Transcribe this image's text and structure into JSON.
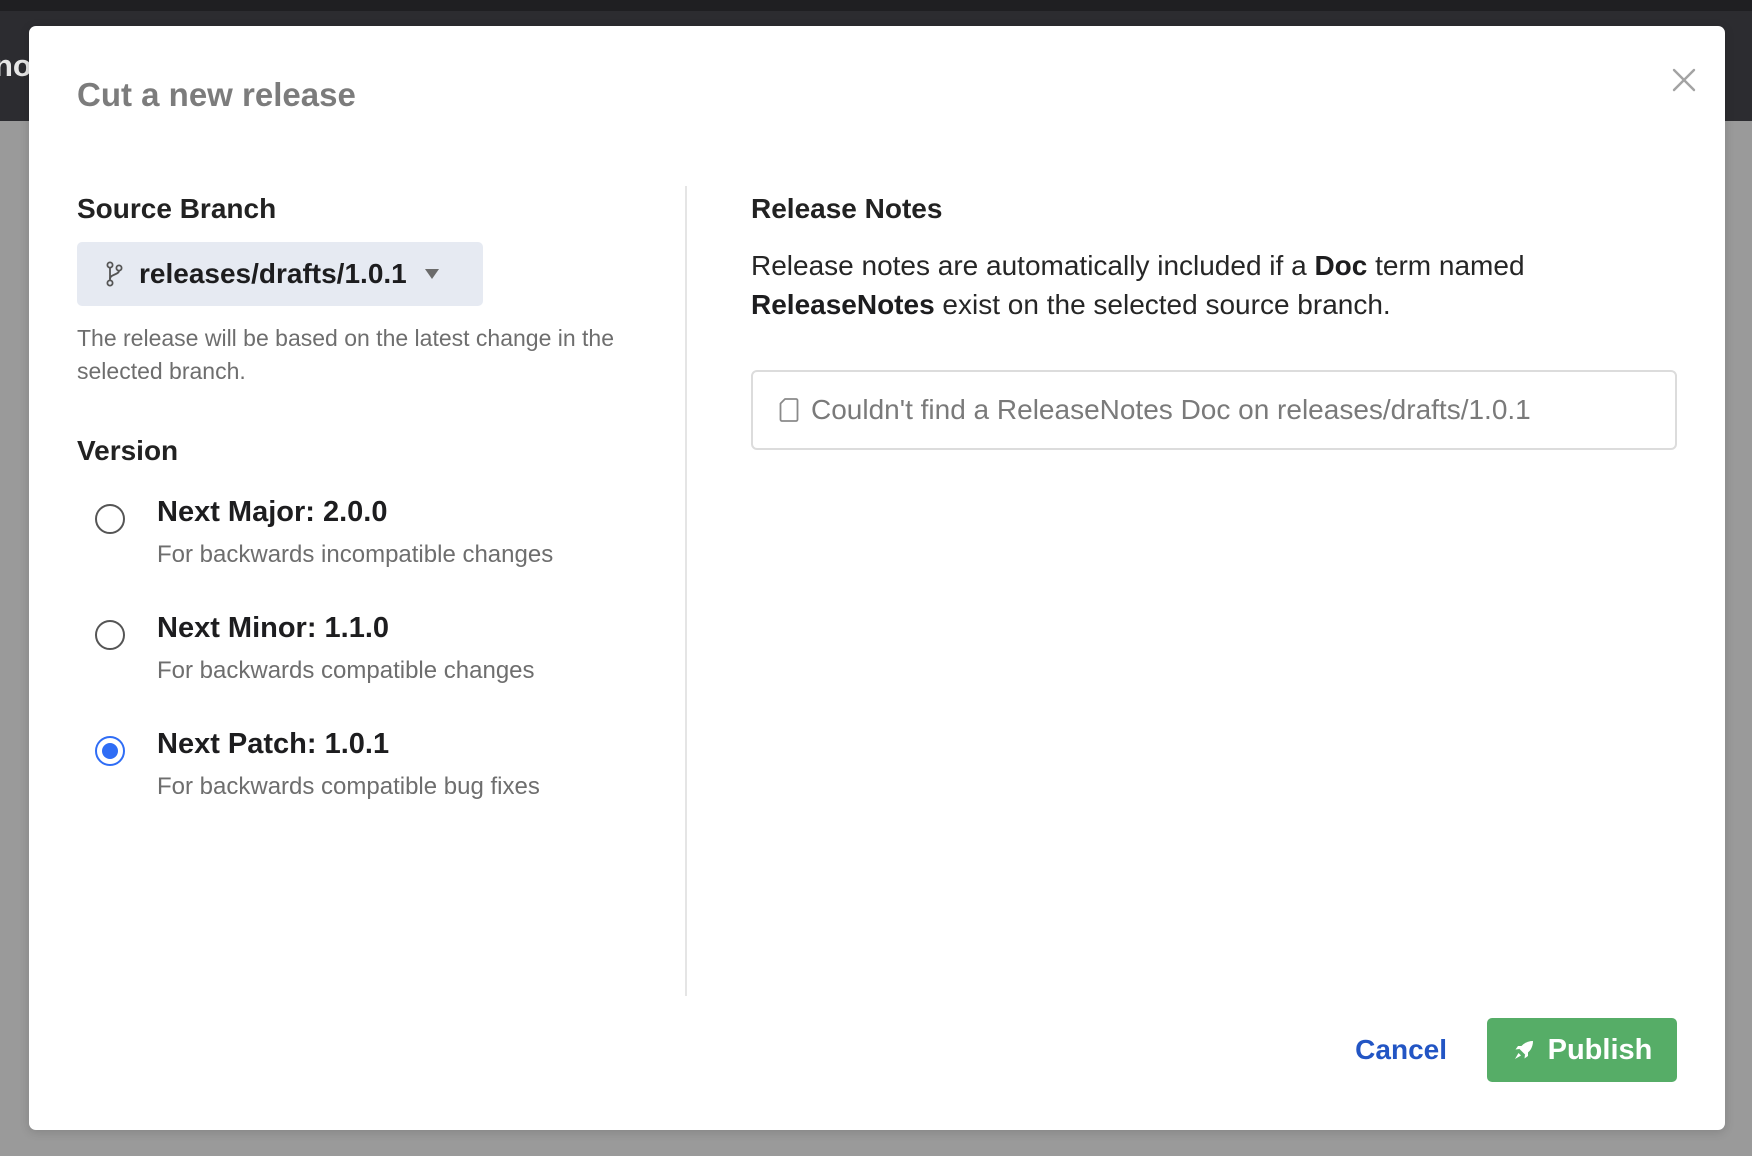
{
  "background": {
    "partial_text": "no"
  },
  "modal": {
    "title": "Cut a new release",
    "close_icon": "close-icon"
  },
  "source_branch": {
    "label": "Source Branch",
    "selected": "releases/drafts/1.0.1",
    "branch_icon": "git-branch-icon",
    "caret_icon": "caret-down-icon",
    "help": "The release will be based on the latest change in the selected branch."
  },
  "version": {
    "label": "Version",
    "options": [
      {
        "title": "Next Major: 2.0.0",
        "description": "For backwards incompatible changes",
        "checked": false
      },
      {
        "title": "Next Minor: 1.1.0",
        "description": "For backwards compatible changes",
        "checked": false
      },
      {
        "title": "Next Patch: 1.0.1",
        "description": "For backwards compatible bug fixes",
        "checked": true
      }
    ]
  },
  "release_notes": {
    "label": "Release Notes",
    "desc_part1": "Release notes are automatically included if a ",
    "desc_bold1": "Doc",
    "desc_part2": " term named ",
    "desc_bold2": "ReleaseNotes",
    "desc_part3": " exist on the selected source branch.",
    "empty_icon": "document-icon",
    "empty_message": "Couldn't find a ReleaseNotes Doc on releases/drafts/1.0.1"
  },
  "footer": {
    "cancel_label": "Cancel",
    "publish_label": "Publish",
    "publish_icon": "rocket-icon"
  },
  "colors": {
    "accent_blue": "#2f6df5",
    "link_blue": "#2255c4",
    "publish_green": "#56ad67",
    "select_bg": "#e6eaf2"
  }
}
